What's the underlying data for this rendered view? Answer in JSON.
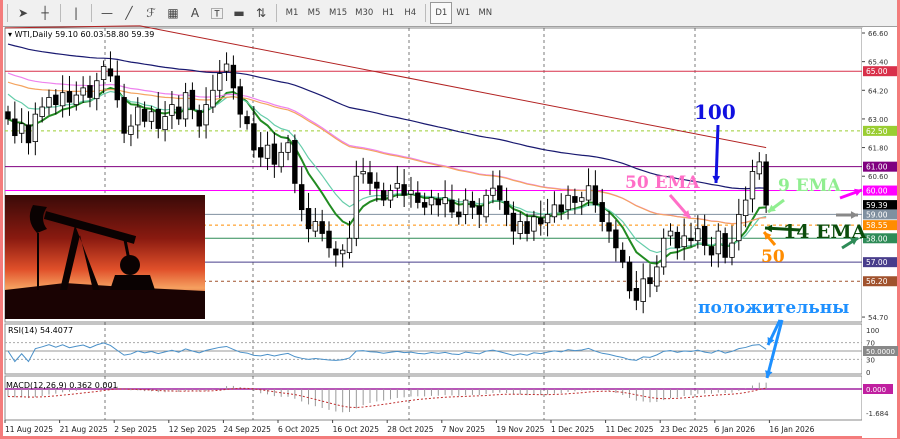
{
  "toolbar": {
    "timeframes": [
      "M1",
      "M5",
      "M15",
      "M30",
      "H1",
      "H4",
      "D1",
      "W1",
      "MN"
    ],
    "selected": "D1",
    "icons": [
      "cursor-icon",
      "crosshair-icon",
      "vertical-line-icon",
      "horizontal-line-icon",
      "trendline-icon",
      "fibonacci-icon",
      "fibo-grid-icon",
      "text-icon",
      "text-label-icon",
      "rectangle-icon",
      "arrows-icon"
    ]
  },
  "chart": {
    "symbol_label": "WTI,Daily",
    "ohlc": "59.10 60.03 58.80 59.39",
    "price_axis": [
      "66.60",
      "65.40",
      "64.20",
      "63.00",
      "61.80",
      "60.60",
      "59.39",
      "54.70"
    ],
    "levels": [
      {
        "label": "65.00",
        "price": 65.0,
        "color": "#d8304a",
        "style": "solid"
      },
      {
        "label": "62.50",
        "price": 62.5,
        "color": "#9acd32",
        "style": "dashed"
      },
      {
        "label": "61.00",
        "price": 61.0,
        "color": "#800080",
        "style": "solid"
      },
      {
        "label": "60.00",
        "price": 60.0,
        "color": "#ff00ff",
        "style": "solid"
      },
      {
        "label": "59.39",
        "price": 59.39,
        "color": "#000000",
        "style": "none"
      },
      {
        "label": "59.00",
        "price": 59.0,
        "color": "#8090a0",
        "style": "solid"
      },
      {
        "label": "58.55",
        "price": 58.55,
        "color": "#ff8c00",
        "style": "dashed"
      },
      {
        "label": "58.00",
        "price": 58.0,
        "color": "#2e8b57",
        "style": "solid"
      },
      {
        "label": "57.00",
        "price": 57.0,
        "color": "#483d8b",
        "style": "solid"
      },
      {
        "label": "56.20",
        "price": 56.2,
        "color": "#a0522d",
        "style": "dashed"
      }
    ],
    "closes": [
      63.0,
      62.3,
      62.8,
      62.0,
      63.2,
      63.5,
      63.9,
      63.6,
      64.1,
      63.7,
      64.0,
      64.3,
      63.9,
      64.6,
      65.2,
      64.8,
      63.8,
      62.4,
      62.7,
      63.5,
      62.9,
      63.3,
      62.6,
      63.1,
      63.6,
      63.0,
      64.1,
      63.4,
      62.7,
      63.6,
      64.2,
      64.9,
      65.3,
      64.3,
      63.2,
      62.8,
      61.7,
      61.4,
      61.9,
      61.1,
      61.6,
      62.0,
      60.3,
      59.2,
      58.4,
      58.7,
      58.2,
      57.6,
      57.3,
      57.5,
      58.0,
      60.6,
      60.8,
      60.3,
      60.1,
      59.6,
      60.0,
      60.3,
      59.8,
      60.0,
      59.5,
      59.3,
      59.7,
      59.4,
      59.7,
      59.1,
      58.9,
      59.6,
      59.3,
      59.0,
      59.8,
      60.1,
      59.6,
      59.0,
      58.3,
      58.7,
      58.2,
      58.9,
      58.6,
      59.0,
      59.4,
      59.1,
      59.8,
      59.5,
      59.7,
      60.2,
      59.4,
      58.7,
      58.3,
      57.6,
      57.0,
      55.8,
      55.4,
      56.3,
      56.1,
      56.8,
      58.0,
      58.3,
      57.6,
      58.1,
      57.9,
      58.4,
      57.7,
      57.3,
      58.3,
      57.2,
      57.8,
      59.0,
      59.6,
      60.8,
      61.2,
      59.39
    ],
    "ma": [
      {
        "name": "EMA 9",
        "period": 9,
        "seed": 63.0,
        "color": "#228b22"
      },
      {
        "name": "EMA 14",
        "period": 14,
        "seed": 64.2,
        "color": "#66cdaa"
      },
      {
        "name": "EMA 50",
        "period": 50,
        "seed": 65.0,
        "color": "#ee82ee"
      },
      {
        "name": "SMA 50",
        "period": 50,
        "seed": 64.6,
        "color": "#f4a460"
      },
      {
        "name": "EMA 100",
        "period": 100,
        "seed": 66.2,
        "color": "#191970"
      }
    ],
    "ma200": {
      "start": 66.9,
      "end": 61.8,
      "color": "#b22222"
    },
    "annotations": {
      "ema100": "100",
      "ema50": "50 EMA",
      "ema9": "9 EMA",
      "ema14": "14 EMA",
      "sma50": "50",
      "positive": "положительны"
    }
  },
  "rsi": {
    "label": "RSI(14) 54.4077",
    "axis": [
      "100",
      "70",
      "50.0000",
      "30",
      "0"
    ]
  },
  "macd": {
    "label": "MACD(12,26,9) 0.362 0.001",
    "axis": [
      "0.000",
      "-1.684"
    ]
  },
  "dates": [
    "11 Aug 2025",
    "21 Aug 2025",
    "2 Sep 2025",
    "12 Sep 2025",
    "24 Sep 2025",
    "6 Oct 2025",
    "16 Oct 2025",
    "28 Oct 2025",
    "7 Nov 2025",
    "19 Nov 2025",
    "1 Dec 2025",
    "11 Dec 2025",
    "23 Dec 2025",
    "6 Jan 2026",
    "16 Jan 2026"
  ]
}
